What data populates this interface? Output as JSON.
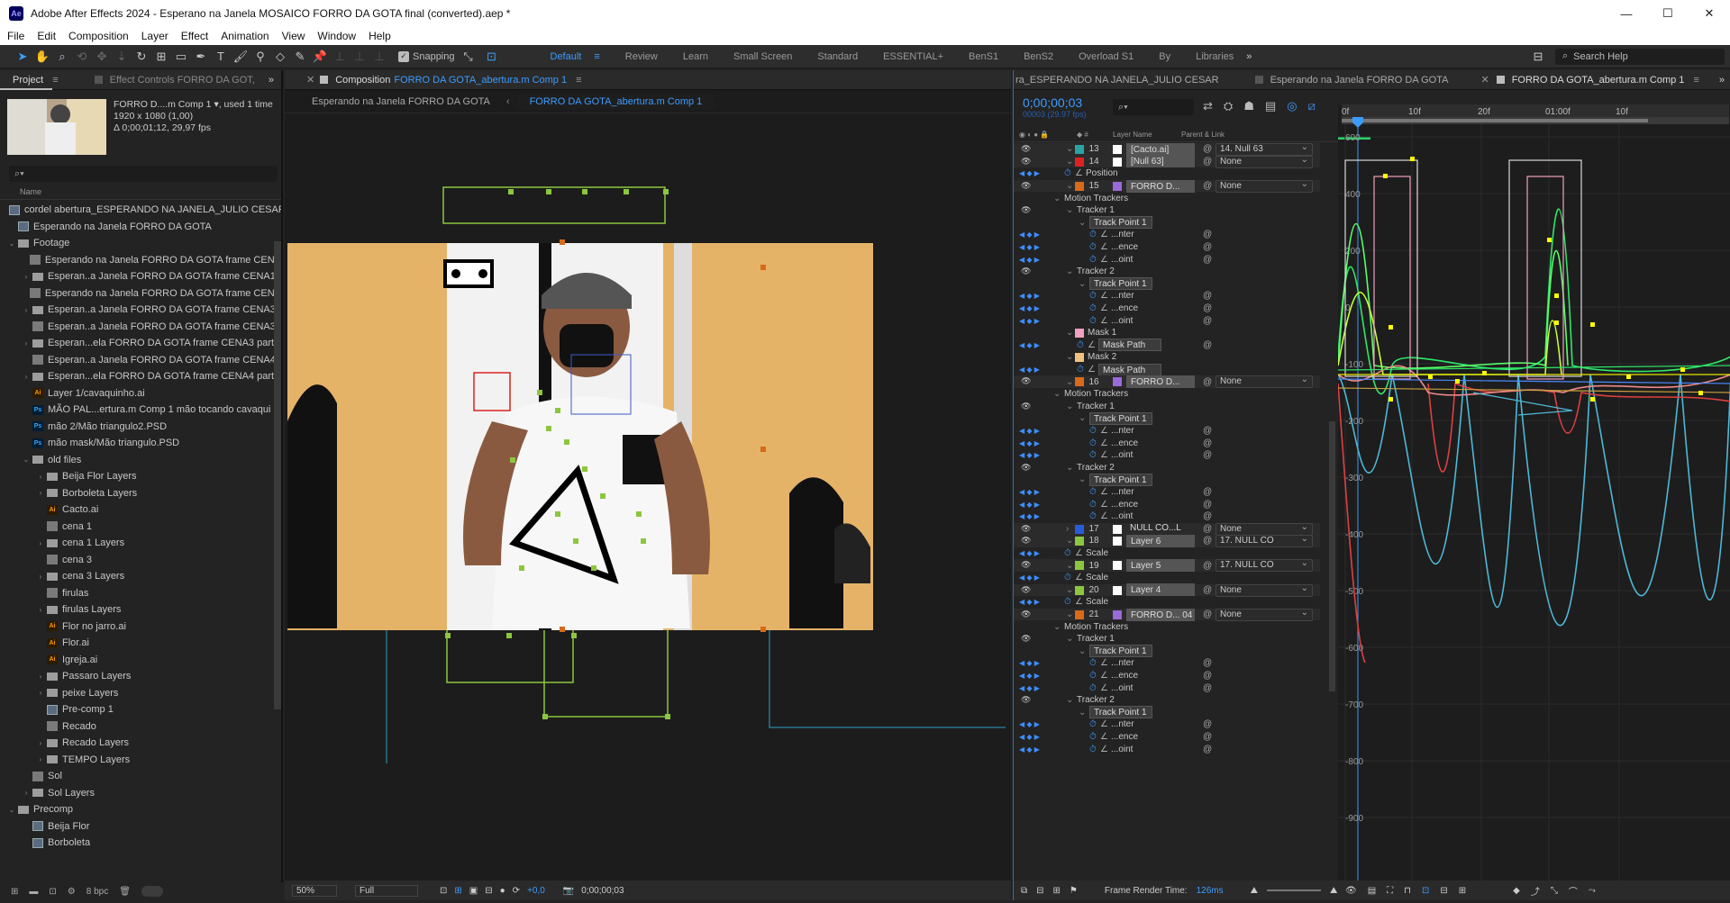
{
  "window": {
    "app_icon": "Ae",
    "title": "Adobe After Effects 2024 - Esperano na Janela MOSAICO FORRO DA GOTA final (converted).aep *",
    "min": "—",
    "max": "☐",
    "close": "✕"
  },
  "menu": [
    "File",
    "Edit",
    "Composition",
    "Layer",
    "Effect",
    "Animation",
    "View",
    "Window",
    "Help"
  ],
  "toolbar": {
    "snapping": "Snapping",
    "workspaces": [
      "Default",
      "Review",
      "Learn",
      "Small Screen",
      "Standard",
      "ESSENTIAL+",
      "BenS1",
      "BenS2",
      "Overload S1",
      "By",
      "Libraries"
    ],
    "active_workspace": "Default",
    "search_help": "Search Help"
  },
  "project": {
    "tab_project": "Project",
    "tab_effects": "Effect Controls FORRO DA GOT,",
    "preview": {
      "name": "FORRO D....m Comp 1",
      "used": ", used 1 time",
      "size": "1920 x 1080 (1,00)",
      "duration": "Δ 0;00;01;12, 29,97 fps"
    },
    "search_placeholder": "",
    "col_name": "Name",
    "items": [
      {
        "indent": 0,
        "tw": "",
        "icon": "comp",
        "label": "cordel abertura_ESPERANDO NA JANELA_JULIO CESAR"
      },
      {
        "indent": 0,
        "tw": "",
        "icon": "comp",
        "label": "Esperando na Janela FORRO DA GOTA"
      },
      {
        "indent": 0,
        "tw": "⌄",
        "icon": "folder",
        "label": "Footage"
      },
      {
        "indent": 1,
        "tw": "",
        "icon": "img",
        "label": "Esperando na Janela FORRO DA GOTA frame CENA"
      },
      {
        "indent": 1,
        "tw": "›",
        "icon": "folder",
        "label": "Esperan..a Janela FORRO DA GOTA frame CENA1"
      },
      {
        "indent": 1,
        "tw": "",
        "icon": "img",
        "label": "Esperando na Janela FORRO DA GOTA frame CENA"
      },
      {
        "indent": 1,
        "tw": "›",
        "icon": "folder",
        "label": "Esperan..a Janela FORRO DA GOTA frame CENA3"
      },
      {
        "indent": 1,
        "tw": "",
        "icon": "img",
        "label": "Esperan..a Janela FORRO DA GOTA frame CENA3"
      },
      {
        "indent": 1,
        "tw": "›",
        "icon": "folder",
        "label": "Esperan...ela FORRO DA GOTA frame CENA3 parte"
      },
      {
        "indent": 1,
        "tw": "",
        "icon": "img",
        "label": "Esperan..a Janela FORRO DA GOTA frame CENA4"
      },
      {
        "indent": 1,
        "tw": "›",
        "icon": "folder",
        "label": "Esperan...ela FORRO DA GOTA frame CENA4 parte"
      },
      {
        "indent": 1,
        "tw": "",
        "icon": "ai",
        "label": "Layer 1/cavaquinho.ai"
      },
      {
        "indent": 1,
        "tw": "",
        "icon": "ps",
        "label": "MÃO PAL...ertura.m Comp 1 mão tocando cavaqui"
      },
      {
        "indent": 1,
        "tw": "",
        "icon": "ps",
        "label": "mão 2/Mão triangulo2.PSD"
      },
      {
        "indent": 1,
        "tw": "",
        "icon": "ps",
        "label": "mão mask/Mão triangulo.PSD"
      },
      {
        "indent": 1,
        "tw": "⌄",
        "icon": "folder",
        "label": "old files"
      },
      {
        "indent": 2,
        "tw": "›",
        "icon": "folder",
        "label": "Beija Flor Layers"
      },
      {
        "indent": 2,
        "tw": "›",
        "icon": "folder",
        "label": "Borboleta Layers"
      },
      {
        "indent": 2,
        "tw": "",
        "icon": "ai",
        "label": "Cacto.ai"
      },
      {
        "indent": 2,
        "tw": "",
        "icon": "img",
        "label": "cena 1"
      },
      {
        "indent": 2,
        "tw": "›",
        "icon": "folder",
        "label": "cena 1 Layers"
      },
      {
        "indent": 2,
        "tw": "",
        "icon": "img",
        "label": "cena 3"
      },
      {
        "indent": 2,
        "tw": "›",
        "icon": "folder",
        "label": "cena 3 Layers"
      },
      {
        "indent": 2,
        "tw": "",
        "icon": "img",
        "label": "firulas"
      },
      {
        "indent": 2,
        "tw": "›",
        "icon": "folder",
        "label": "firulas Layers"
      },
      {
        "indent": 2,
        "tw": "",
        "icon": "ai",
        "label": "Flor no jarro.ai"
      },
      {
        "indent": 2,
        "tw": "",
        "icon": "ai",
        "label": "Flor.ai"
      },
      {
        "indent": 2,
        "tw": "",
        "icon": "ai",
        "label": "Igreja.ai"
      },
      {
        "indent": 2,
        "tw": "›",
        "icon": "folder",
        "label": "Passaro Layers"
      },
      {
        "indent": 2,
        "tw": "›",
        "icon": "folder",
        "label": "peixe Layers"
      },
      {
        "indent": 2,
        "tw": "",
        "icon": "comp",
        "label": "Pre-comp 1"
      },
      {
        "indent": 2,
        "tw": "",
        "icon": "img",
        "label": "Recado"
      },
      {
        "indent": 2,
        "tw": "›",
        "icon": "folder",
        "label": "Recado Layers"
      },
      {
        "indent": 2,
        "tw": "›",
        "icon": "folder",
        "label": "TEMPO Layers"
      },
      {
        "indent": 1,
        "tw": "",
        "icon": "img",
        "label": "Sol"
      },
      {
        "indent": 1,
        "tw": "›",
        "icon": "folder",
        "label": "Sol Layers"
      },
      {
        "indent": 0,
        "tw": "⌄",
        "icon": "folder",
        "label": "Precomp"
      },
      {
        "indent": 1,
        "tw": "",
        "icon": "comp",
        "label": "Beija Flor"
      },
      {
        "indent": 1,
        "tw": "",
        "icon": "comp",
        "label": "Borboleta"
      }
    ],
    "bpc": "8 bpc"
  },
  "viewer": {
    "tab_prefix": "Composition",
    "tab_name": "FORRO DA GOTA_abertura.m Comp 1",
    "crumb1": "Esperando na Janela FORRO DA GOTA",
    "crumb2": "FORRO DA GOTA_abertura.m Comp 1",
    "zoom": "50%",
    "resolution": "Full",
    "exposure": "+0,0",
    "timecode": "0;00;00;03"
  },
  "timeline": {
    "tabs": [
      "ra_ESPERANDO NA JANELA_JULIO CESAR",
      "Esperando na Janela FORRO DA GOTA",
      "FORRO DA GOTA_abertura.m Comp 1"
    ],
    "timecode": "0;00;00;03",
    "fps": "00003 (29.97 fps)",
    "col_layer": "Layer Name",
    "col_parent": "Parent & Link",
    "ruler": [
      "0f",
      "10f",
      "20f",
      "01:00f",
      "10f"
    ],
    "yticks": [
      "600",
      "400",
      "200",
      "0",
      "-100",
      "-200",
      "-300",
      "-400",
      "-500",
      "-600",
      "-700",
      "-800",
      "-900"
    ],
    "frame_render": "Frame Render Time:",
    "frame_render_val": "126ms",
    "rows": [
      {
        "type": "layer",
        "num": "13",
        "color": "#2aa3a3",
        "name": "[Cacto.ai]",
        "parent": "14. Null 63"
      },
      {
        "type": "layer",
        "num": "14",
        "color": "#d22",
        "name": "[Null 63]",
        "parent": "None"
      },
      {
        "type": "prop",
        "indent": 2,
        "name": "Position",
        "kf": true
      },
      {
        "type": "layer",
        "num": "15",
        "color": "#d86a1a",
        "name": "FORRO D...",
        "parent": "None",
        "comp": true
      },
      {
        "type": "group",
        "indent": 1,
        "name": "Motion Trackers"
      },
      {
        "type": "group",
        "indent": 2,
        "name": "Tracker 1",
        "eye": true
      },
      {
        "type": "group",
        "indent": 3,
        "name": "Track Point 1",
        "box": true
      },
      {
        "type": "prop",
        "indent": 4,
        "name": "...nter",
        "kf": true,
        "link": true
      },
      {
        "type": "prop",
        "indent": 4,
        "name": "...ence",
        "kf": true,
        "link": true
      },
      {
        "type": "prop",
        "indent": 4,
        "name": "...oint",
        "kf": true,
        "link": true
      },
      {
        "type": "group",
        "indent": 2,
        "name": "Tracker 2",
        "eye": true
      },
      {
        "type": "group",
        "indent": 3,
        "name": "Track Point 1",
        "box": true
      },
      {
        "type": "prop",
        "indent": 4,
        "name": "...nter",
        "kf": true,
        "link": true
      },
      {
        "type": "prop",
        "indent": 4,
        "name": "...ence",
        "kf": true,
        "link": true
      },
      {
        "type": "prop",
        "indent": 4,
        "name": "...oint",
        "kf": true,
        "link": true
      },
      {
        "type": "group",
        "indent": 2,
        "name": "Mask 1",
        "mask": "#f0a0c0"
      },
      {
        "type": "prop",
        "indent": 3,
        "name": "Mask Path",
        "kf": true,
        "link": true,
        "box": true
      },
      {
        "type": "group",
        "indent": 2,
        "name": "Mask 2",
        "mask": "#f0c080"
      },
      {
        "type": "prop",
        "indent": 3,
        "name": "Mask Path",
        "kf": true,
        "box": true
      },
      {
        "type": "layer",
        "num": "16",
        "color": "#d86a1a",
        "name": "FORRO D...",
        "parent": "None",
        "comp": true
      },
      {
        "type": "group",
        "indent": 1,
        "name": "Motion Trackers"
      },
      {
        "type": "group",
        "indent": 2,
        "name": "Tracker 1",
        "eye": true
      },
      {
        "type": "group",
        "indent": 3,
        "name": "Track Point 1",
        "box": true
      },
      {
        "type": "prop",
        "indent": 4,
        "name": "...nter",
        "kf": true,
        "link": true
      },
      {
        "type": "prop",
        "indent": 4,
        "name": "...ence",
        "kf": true,
        "link": true
      },
      {
        "type": "prop",
        "indent": 4,
        "name": "...oint",
        "kf": true,
        "link": true
      },
      {
        "type": "group",
        "indent": 2,
        "name": "Tracker 2",
        "eye": true
      },
      {
        "type": "group",
        "indent": 3,
        "name": "Track Point 1",
        "box": true
      },
      {
        "type": "prop",
        "indent": 4,
        "name": "...nter",
        "kf": true,
        "link": true
      },
      {
        "type": "prop",
        "indent": 4,
        "name": "...ence",
        "kf": true,
        "link": true
      },
      {
        "type": "prop",
        "indent": 4,
        "name": "...oint",
        "kf": true,
        "link": true
      },
      {
        "type": "layer",
        "num": "17",
        "color": "#2a5bd8",
        "name": "NULL CO...L",
        "parent": "None",
        "plain": true
      },
      {
        "type": "layer",
        "num": "18",
        "color": "#8cc63f",
        "name": "Layer 6",
        "parent": "17. NULL CO"
      },
      {
        "type": "prop",
        "indent": 2,
        "name": "Scale",
        "kf": true
      },
      {
        "type": "layer",
        "num": "19",
        "color": "#8cc63f",
        "name": "Layer 5",
        "parent": "17. NULL CO"
      },
      {
        "type": "prop",
        "indent": 2,
        "name": "Scale",
        "kf": true
      },
      {
        "type": "layer",
        "num": "20",
        "color": "#8cc63f",
        "name": "Layer 4",
        "parent": "None"
      },
      {
        "type": "prop",
        "indent": 2,
        "name": "Scale",
        "kf": true
      },
      {
        "type": "layer",
        "num": "21",
        "color": "#d86a1a",
        "name": "FORRO D... 04",
        "parent": "None",
        "comp": true
      },
      {
        "type": "group",
        "indent": 1,
        "name": "Motion Trackers"
      },
      {
        "type": "group",
        "indent": 2,
        "name": "Tracker 1",
        "eye": true
      },
      {
        "type": "group",
        "indent": 3,
        "name": "Track Point 1",
        "box": true
      },
      {
        "type": "prop",
        "indent": 4,
        "name": "...nter",
        "kf": true,
        "link": true
      },
      {
        "type": "prop",
        "indent": 4,
        "name": "...ence",
        "kf": true,
        "link": true
      },
      {
        "type": "prop",
        "indent": 4,
        "name": "...oint",
        "kf": true,
        "link": true
      },
      {
        "type": "group",
        "indent": 2,
        "name": "Tracker 2",
        "eye": true
      },
      {
        "type": "group",
        "indent": 3,
        "name": "Track Point 1",
        "box": true
      },
      {
        "type": "prop",
        "indent": 4,
        "name": "...nter",
        "kf": true,
        "link": true
      },
      {
        "type": "prop",
        "indent": 4,
        "name": "...ence",
        "kf": true,
        "link": true
      },
      {
        "type": "prop",
        "indent": 4,
        "name": "...oint",
        "kf": true,
        "link": true
      }
    ]
  }
}
